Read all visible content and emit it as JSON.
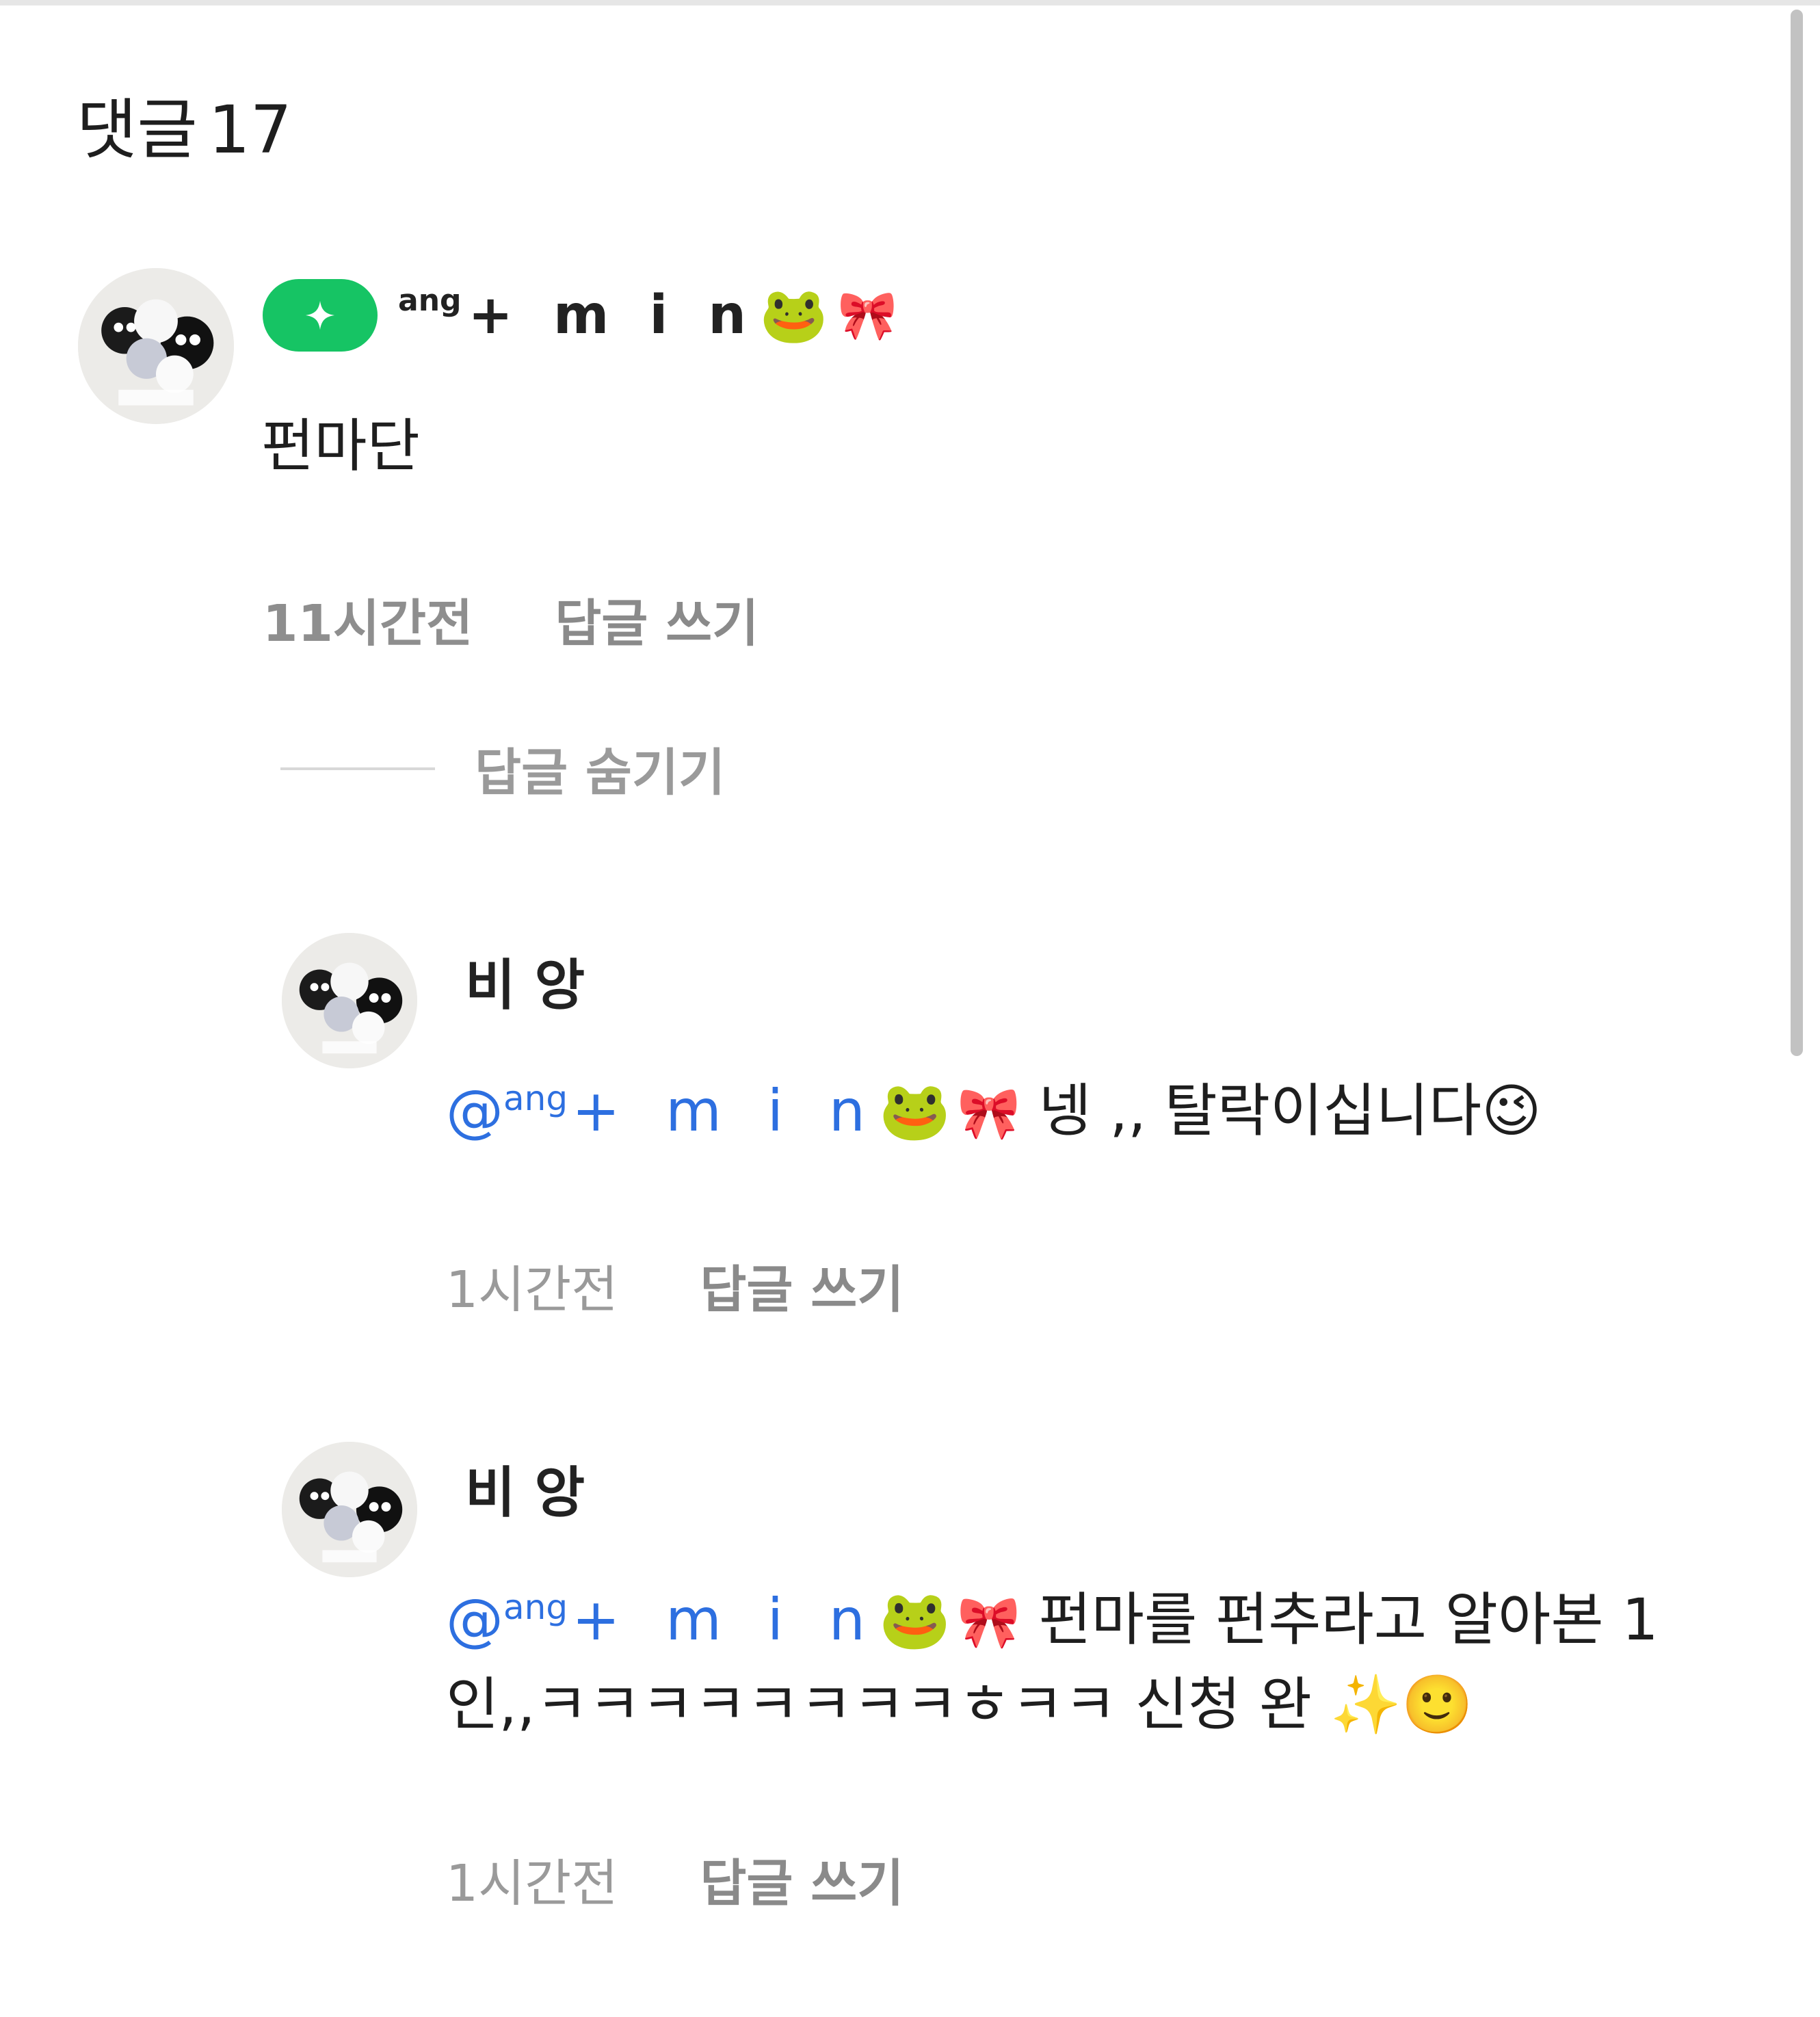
{
  "header": {
    "title": "댓글",
    "count": "17"
  },
  "comments": [
    {
      "author": {
        "sup": "ang",
        "main": "+ m i n",
        "emoji": "🐸",
        "deco": "🎀",
        "badge_icon": "sparkle-icon",
        "badge_color": "#16c464"
      },
      "text": "펀마단",
      "time": "11시간전",
      "reply_label": "답글 쓰기",
      "hide_replies_label": "답글 숨기기",
      "replies": [
        {
          "author": "비 앙",
          "mention": {
            "at": "@",
            "sup": "ang",
            "main": "+ m i n",
            "emoji": "🐸",
            "deco": "🎀"
          },
          "text_line1": "넹 ,, 탈락이십니다😉",
          "time": "1시간전",
          "reply_label": "답글 쓰기"
        },
        {
          "author": "비 앙",
          "mention": {
            "at": "@",
            "sup": "ang",
            "main": "+ m i n",
            "emoji": "🐸",
            "deco": "🎀"
          },
          "text_line1": "펀마를 펀추라고 알아본 1",
          "text_line2": "인,,ㅋㅋㅋㅋㅋㅋㅋㅋㅎㅋㅋ 신청 완 ✨🙂",
          "time": "1시간전",
          "reply_label": "답글 쓰기"
        }
      ]
    }
  ],
  "colors": {
    "mention": "#2d6fe0",
    "badge": "#16c464",
    "meta": "#9a9a9a"
  }
}
